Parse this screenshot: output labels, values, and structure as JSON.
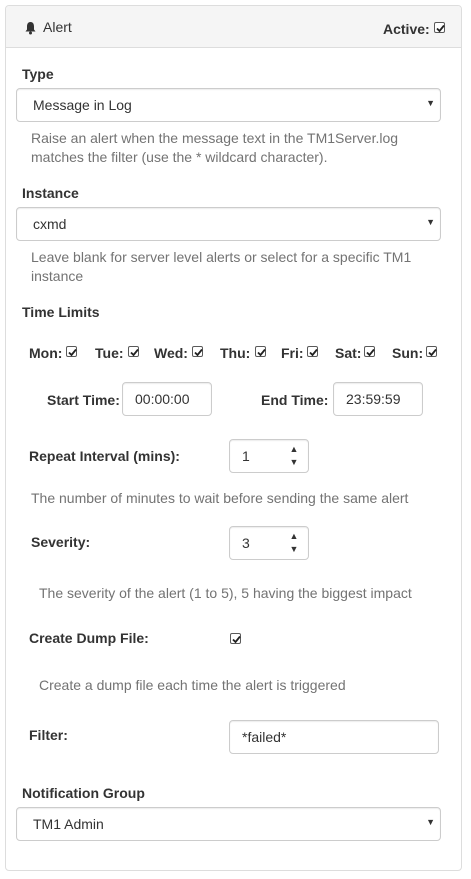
{
  "header": {
    "title": "Alert",
    "active_label": "Active:",
    "active_checked": true,
    "icon": "bell-icon"
  },
  "type": {
    "label": "Type",
    "selected": "Message in Log",
    "help_line1": "Raise an alert when the message text in the TM1Server.log",
    "help_line2": "matches the filter (use the * wildcard character)."
  },
  "instance": {
    "label": "Instance",
    "selected": "cxmd",
    "help_line1": "Leave blank for server level alerts or select for a specific TM1",
    "help_line2": "instance"
  },
  "time_limits": {
    "label": "Time Limits",
    "days": [
      {
        "label": "Mon:",
        "checked": true
      },
      {
        "label": "Tue:",
        "checked": true
      },
      {
        "label": "Wed:",
        "checked": true
      },
      {
        "label": "Thu:",
        "checked": true
      },
      {
        "label": "Fri:",
        "checked": true
      },
      {
        "label": "Sat:",
        "checked": true
      },
      {
        "label": "Sun:",
        "checked": true
      }
    ],
    "start_label": "Start Time:",
    "start_value": "00:00:00",
    "end_label": "End Time:",
    "end_value": "23:59:59"
  },
  "repeat": {
    "label": "Repeat Interval (mins):",
    "value": "1",
    "help": "The number of minutes to wait before sending the same alert"
  },
  "severity": {
    "label": "Severity:",
    "value": "3",
    "help": "The severity of the alert (1 to 5), 5 having the biggest impact"
  },
  "dump": {
    "label": "Create Dump File:",
    "checked": true,
    "help": "Create a dump file each time the alert is triggered"
  },
  "filter": {
    "label": "Filter:",
    "value": "*failed*"
  },
  "notification": {
    "label": "Notification Group",
    "selected": "TM1 Admin"
  },
  "glyphs": {
    "caret": "▼",
    "spin_up": "▲",
    "spin_down": "▼"
  }
}
